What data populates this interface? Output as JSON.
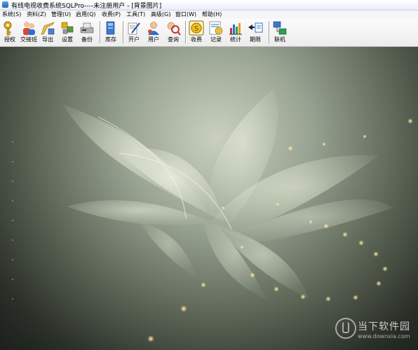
{
  "window": {
    "title": "有线电视收费系统SQLPro----未注册用户 - [背景图片]"
  },
  "menu": [
    "系统(S)",
    "资料(Z)",
    "管理(U)",
    "启用(Q)",
    "收费(P)",
    "工具(T)",
    "高级(G)",
    "窗口(W)",
    "帮助(H)"
  ],
  "toolbar": [
    {
      "label": "授权",
      "icon": "key-icon"
    },
    {
      "label": "交接班",
      "icon": "users-shift-icon"
    },
    {
      "label": "导出",
      "icon": "export-icon"
    },
    {
      "label": "设置",
      "icon": "settings-icon"
    },
    {
      "label": "备份",
      "icon": "backup-icon"
    },
    {
      "label": "库存",
      "icon": "inventory-icon"
    },
    {
      "label": "开户",
      "icon": "open-account-icon"
    },
    {
      "label": "用户",
      "icon": "user-icon"
    },
    {
      "label": "查询",
      "icon": "query-icon"
    },
    {
      "label": "收费",
      "icon": "charge-icon"
    },
    {
      "label": "记录",
      "icon": "record-icon"
    },
    {
      "label": "统计",
      "icon": "statistics-icon"
    },
    {
      "label": "期限",
      "icon": "deadline-icon"
    },
    {
      "label": "联机",
      "icon": "network-icon"
    }
  ],
  "watermark": {
    "title": "当下软件园",
    "url": "www.downxia.com"
  }
}
